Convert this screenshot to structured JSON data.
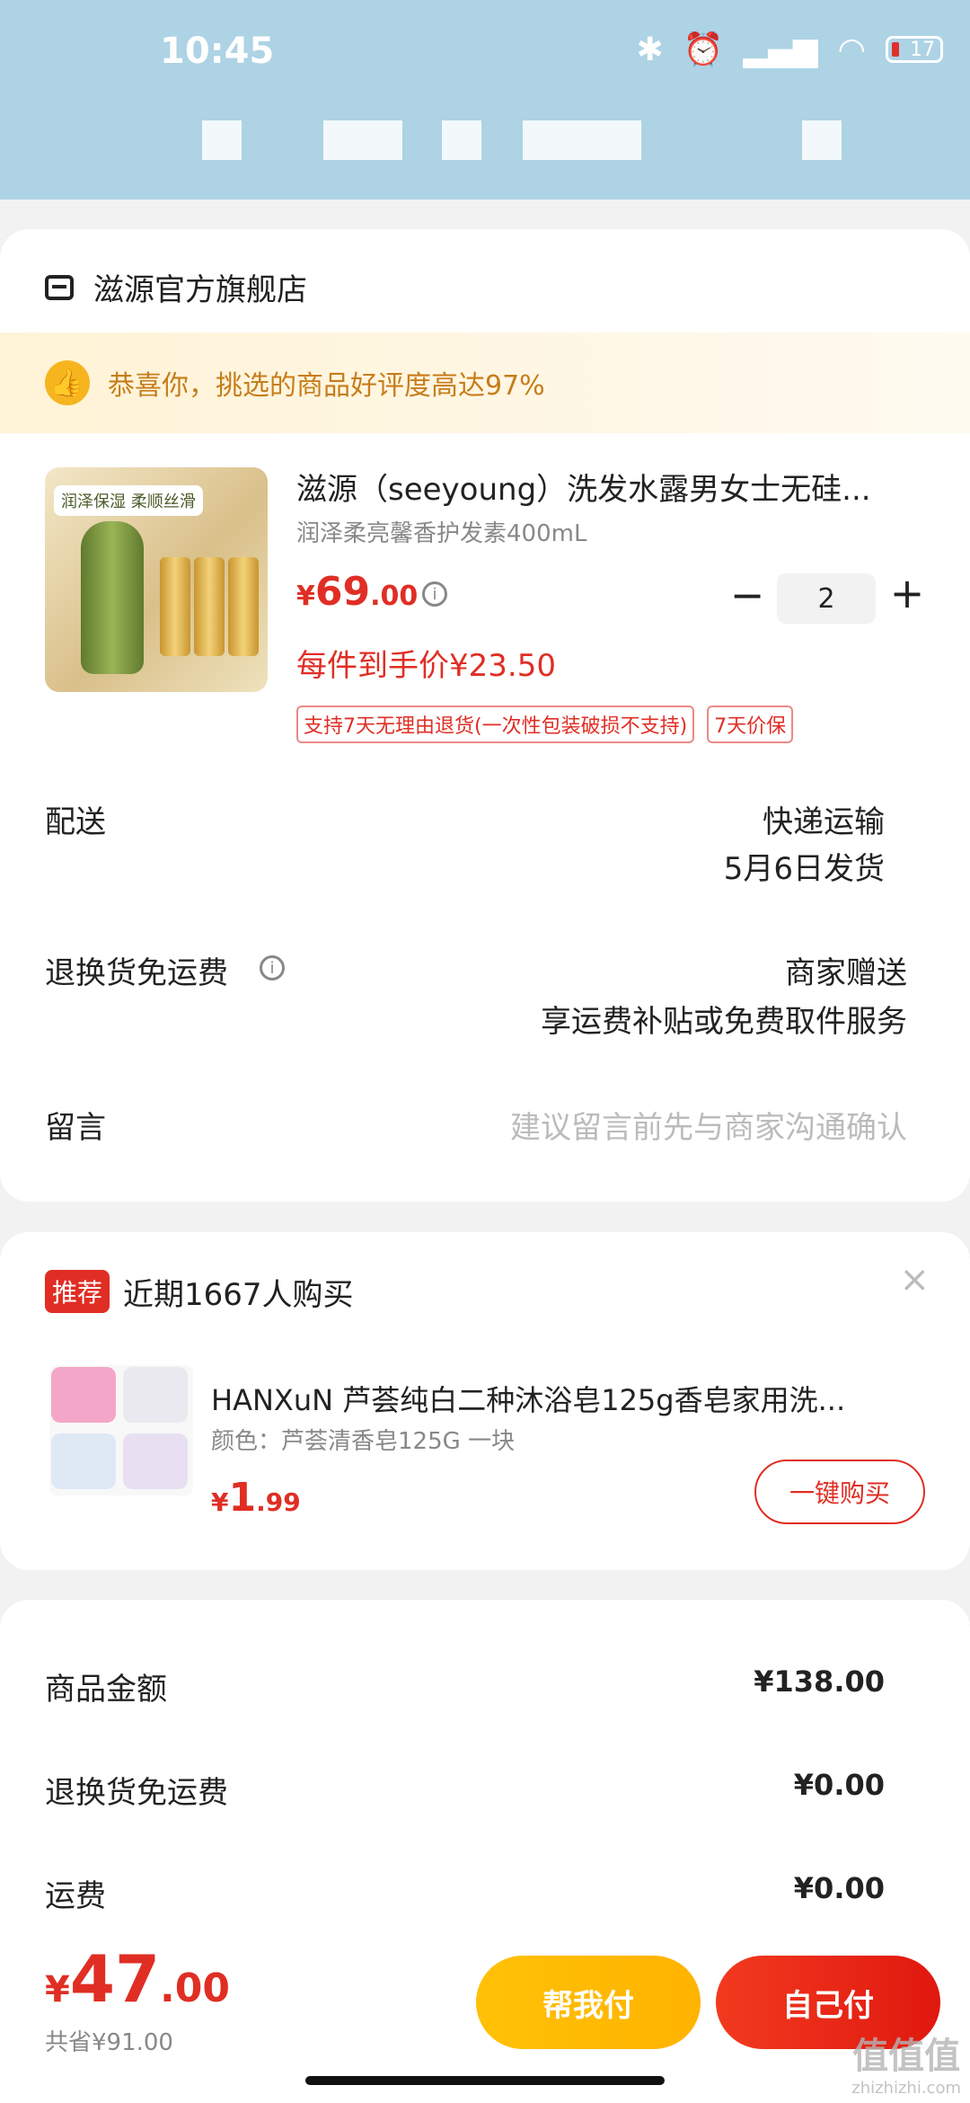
{
  "status_bar": {
    "time": "10:45",
    "battery": "17"
  },
  "shop": {
    "name": "滋源官方旗舰店"
  },
  "praise": {
    "text": "恭喜你，挑选的商品好评度高达97%"
  },
  "product": {
    "title": "滋源（seeyoung）洗发水露男女士无硅...",
    "spec": "润泽柔亮馨香护发素400mL",
    "price_currency": "¥",
    "price_int": "69",
    "price_dec": ".00",
    "quantity": "2",
    "unit_price": "每件到手价¥23.50",
    "image_tag": "润泽保湿 柔顺丝滑",
    "tags": [
      "支持7天无理由退货(一次性包装破损不支持)",
      "7天价保"
    ]
  },
  "rows": {
    "delivery_label": "配送",
    "delivery_value1": "快递运输",
    "delivery_value2": "5月6日发货",
    "return_label": "退换货免运费",
    "return_value1": "商家赠送",
    "return_value2": "享运费补贴或免费取件服务",
    "message_label": "留言",
    "message_placeholder": "建议留言前先与商家沟通确认"
  },
  "recommend": {
    "badge": "推荐",
    "title": "近期1667人购买",
    "close": "×",
    "item_title": "HANXuN 芦荟纯白二种沐浴皂125g香皂家用洗...",
    "item_spec": "颜色：芦荟清香皂125G 一块",
    "price_currency": "¥",
    "price_int": "1",
    "price_dec": ".99",
    "buy_label": "一键购买"
  },
  "summary": {
    "goods_label": "商品金额",
    "goods_value": "¥138.00",
    "return_label": "退换货免运费",
    "return_value": "¥0.00",
    "shipping_label": "运费",
    "shipping_value": "¥0.00"
  },
  "footer": {
    "total_currency": "¥",
    "total_int": "47",
    "total_dec": ".00",
    "saved": "共省¥91.00",
    "help_pay": "帮我付",
    "self_pay": "自己付"
  },
  "watermark": {
    "main": "值值值",
    "sub": "zhizhizhi.com"
  },
  "colors": {
    "accent": "#e02e24",
    "header_bg": "#add3e4",
    "help_btn": "#ffc107"
  }
}
